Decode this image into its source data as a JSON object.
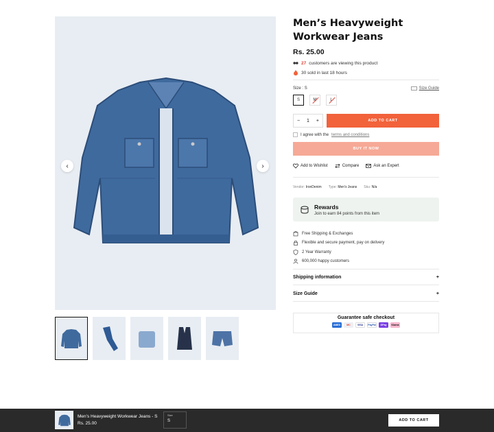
{
  "product": {
    "title": "Men’s Heavyweight Workwear Jeans",
    "price": "Rs. 25.00",
    "viewing_count": "27",
    "viewing_text": "customers are viewing this product",
    "sold_text": "30 sold in last 18 hours"
  },
  "gallery": {
    "prev_icon": "chevron-left-icon",
    "next_icon": "chevron-right-icon",
    "thumbnails": [
      "denim jacket",
      "folded jeans",
      "shirt",
      "vest",
      "shorts"
    ]
  },
  "size": {
    "label": "Size :",
    "selected": "S",
    "guide_label": "Size Guide",
    "options": [
      {
        "label": "S",
        "available": true
      },
      {
        "label": "M",
        "available": false
      },
      {
        "label": "L",
        "available": false
      }
    ]
  },
  "cart": {
    "qty_minus": "−",
    "qty_value": "1",
    "qty_plus": "+",
    "add_to_cart": "ADD TO CART",
    "agree_text": "I agree with the",
    "terms_link": "terms and conditions",
    "buy_now": "BUY IT NOW"
  },
  "actions": {
    "wishlist": "Add to Wishlist",
    "compare": "Compare",
    "expert": "Ask an Expert"
  },
  "details": {
    "vendor_label": "Vendor:",
    "vendor": "IronDenim",
    "type_label": "Type:",
    "type": "Men's Jeans",
    "sku_label": "Sku:",
    "sku": "N/a"
  },
  "rewards": {
    "title": "Rewards",
    "subtitle": "Join to earn 84 points from this item"
  },
  "perks": [
    "Free Shipping & Exchanges",
    "Flexible and secure payment, pay on delivery",
    "2 Year Warranty",
    "600,000 happy customers"
  ],
  "accordions": {
    "shipping": "Shipping information",
    "size_guide": "Size Guide",
    "toggle": "+"
  },
  "guarantee": {
    "title": "Guarantee safe checkout",
    "methods": [
      "AMEX",
      "MC",
      "VISA",
      "PayPal",
      "GPay",
      "Klarna"
    ]
  },
  "sticky": {
    "name": "Men’s Heavyweight Workwear Jeans - S",
    "price": "Rs. 25.00",
    "size_label": "Size",
    "size_value": "S",
    "add_to_cart": "ADD TO CART"
  },
  "colors": {
    "accent": "#f2623b",
    "buy_now": "#f6a996",
    "sticky_bg": "#2a2a2a",
    "image_bg": "#e8edf3"
  }
}
